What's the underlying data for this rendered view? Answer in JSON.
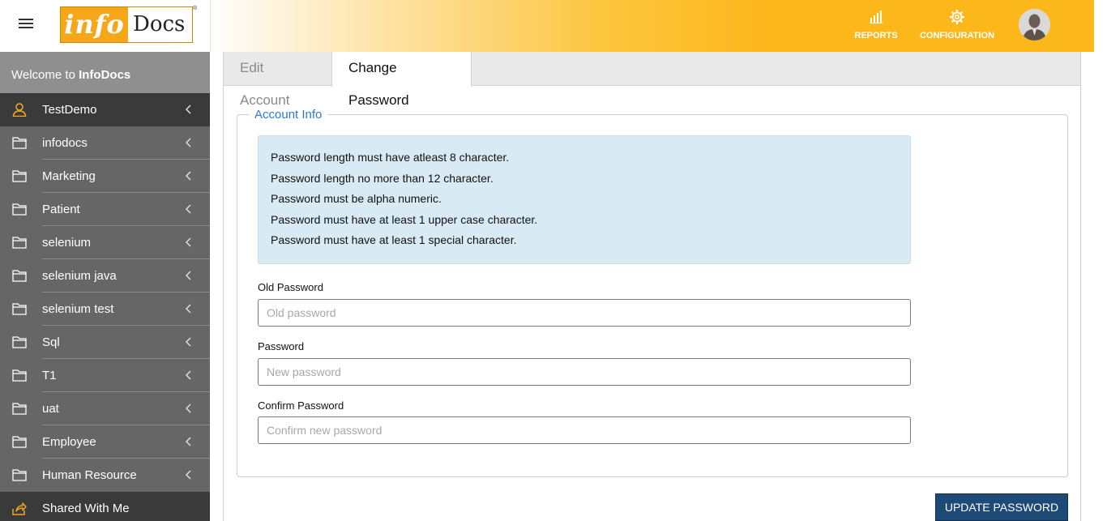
{
  "header": {
    "logo_info": "info",
    "logo_docs": "Docs",
    "logo_reg": "®",
    "nav": [
      {
        "label": "REPORTS",
        "icon": "bar-chart-icon"
      },
      {
        "label": "CONFIGURATION",
        "icon": "gear-icon"
      }
    ],
    "accent": "#fcb71b"
  },
  "sidebar": {
    "welcome_prefix": "Welcome to ",
    "welcome_brand": "InfoDocs",
    "items": [
      {
        "label": "TestDemo",
        "icon": "user-icon"
      },
      {
        "label": "infodocs",
        "icon": "folder-icon"
      },
      {
        "label": "Marketing",
        "icon": "folder-icon"
      },
      {
        "label": "Patient",
        "icon": "folder-icon"
      },
      {
        "label": "selenium",
        "icon": "folder-icon"
      },
      {
        "label": "selenium java",
        "icon": "folder-icon"
      },
      {
        "label": "selenium test",
        "icon": "folder-icon"
      },
      {
        "label": "Sql",
        "icon": "folder-icon"
      },
      {
        "label": "T1",
        "icon": "folder-icon"
      },
      {
        "label": "uat",
        "icon": "folder-icon"
      },
      {
        "label": "Employee",
        "icon": "folder-icon"
      },
      {
        "label": "Human Resource",
        "icon": "folder-icon"
      },
      {
        "label": "Shared With Me",
        "icon": "share-icon"
      }
    ]
  },
  "tabs": [
    {
      "label": "Edit Account"
    },
    {
      "label": "Change Password"
    }
  ],
  "form": {
    "legend": "Account Info",
    "rules": [
      "Password length must have atleast 8 character.",
      "Password length no more than 12 character.",
      "Password must be alpha numeric.",
      "Password must have at least 1 upper case character.",
      "Password must have at least 1 special character."
    ],
    "old_password": {
      "label": "Old Password",
      "placeholder": "Old password"
    },
    "password": {
      "label": "Password",
      "placeholder": "New password"
    },
    "confirm_password": {
      "label": "Confirm Password",
      "placeholder": "Confirm new password"
    },
    "submit_label": "UPDATE PASSWORD"
  }
}
